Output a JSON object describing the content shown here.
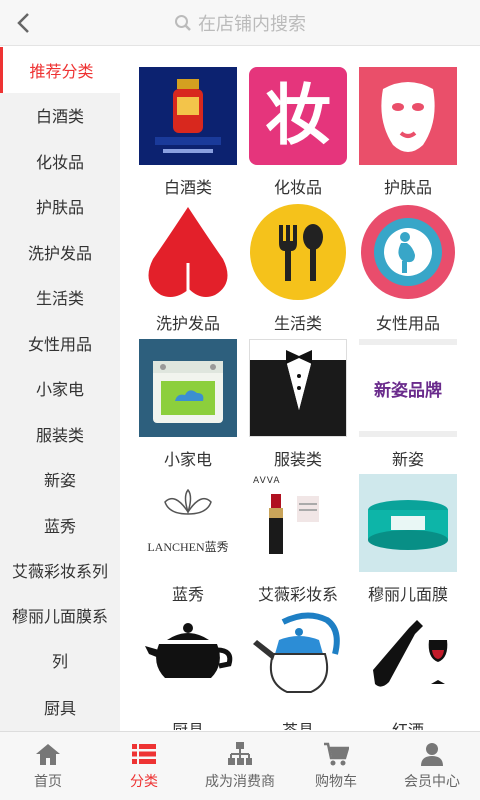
{
  "header": {
    "search_placeholder": "在店铺内搜索"
  },
  "sidebar": {
    "items": [
      {
        "label": "推荐分类"
      },
      {
        "label": "白酒类"
      },
      {
        "label": "化妆品"
      },
      {
        "label": "护肤品"
      },
      {
        "label": "洗护发品"
      },
      {
        "label": "生活类"
      },
      {
        "label": "女性用品"
      },
      {
        "label": "小家电"
      },
      {
        "label": "服装类"
      },
      {
        "label": "新姿"
      },
      {
        "label": "蓝秀"
      },
      {
        "label": "艾薇彩妆系列"
      },
      {
        "label": "穆丽儿面膜系列"
      },
      {
        "label": "厨具"
      }
    ]
  },
  "grid": {
    "items": [
      {
        "label": "白酒类",
        "icon": "baijiu-bottle-icon"
      },
      {
        "label": "化妆品",
        "icon": "cosmetics-zhuang-icon",
        "text": "妆"
      },
      {
        "label": "护肤品",
        "icon": "face-mask-icon"
      },
      {
        "label": "洗护发品",
        "icon": "drop-icon"
      },
      {
        "label": "生活类",
        "icon": "fork-spoon-icon"
      },
      {
        "label": "女性用品",
        "icon": "pregnancy-icon"
      },
      {
        "label": "小家电",
        "icon": "oven-icon"
      },
      {
        "label": "服装类",
        "icon": "tuxedo-icon"
      },
      {
        "label": "新姿",
        "icon": "xinzi-brand-icon",
        "text": "新姿品牌"
      },
      {
        "label": "蓝秀",
        "icon": "lanchen-logo-icon",
        "text": "LANCHEN蓝秀"
      },
      {
        "label": "艾薇彩妆系",
        "icon": "lipstick-icon",
        "text": "AVVA"
      },
      {
        "label": "穆丽儿面膜",
        "icon": "mask-jar-icon"
      },
      {
        "label": "厨具",
        "icon": "teapot-icon"
      },
      {
        "label": "茶具",
        "icon": "kettle-icon"
      },
      {
        "label": "红酒",
        "icon": "wine-icon"
      }
    ]
  },
  "tabbar": {
    "items": [
      {
        "label": "首页",
        "icon": "home-icon"
      },
      {
        "label": "分类",
        "icon": "category-icon"
      },
      {
        "label": "成为消费商",
        "icon": "network-icon"
      },
      {
        "label": "购物车",
        "icon": "cart-icon"
      },
      {
        "label": "会员中心",
        "icon": "user-icon"
      }
    ]
  },
  "colors": {
    "accent": "#e33333",
    "sidebar_bg": "#f2f2f2"
  }
}
